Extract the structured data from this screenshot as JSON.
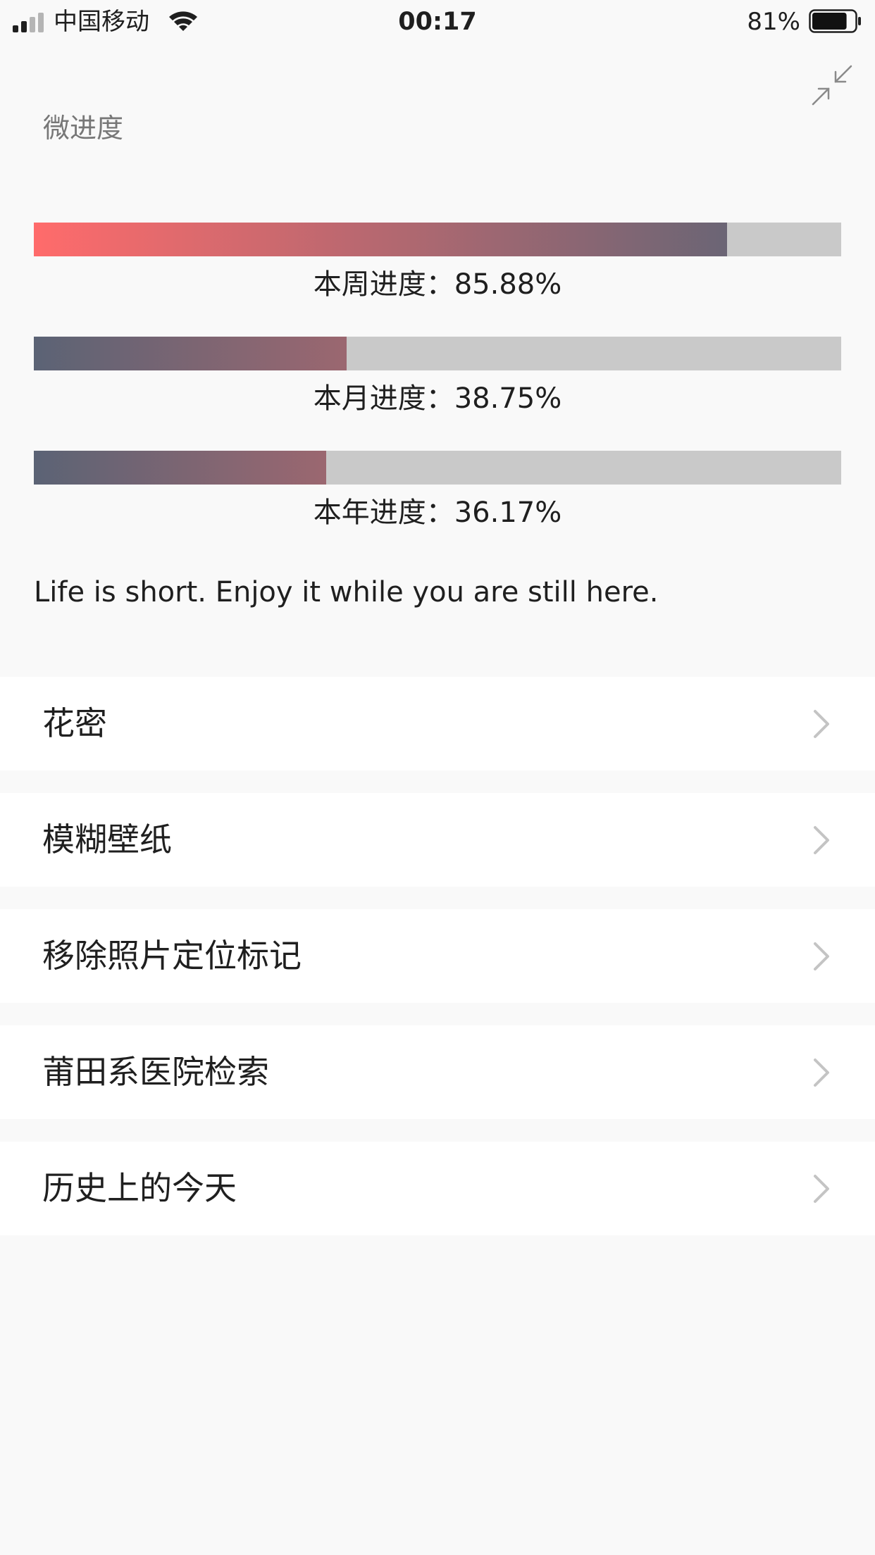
{
  "status_bar": {
    "carrier": "中国移动",
    "time": "00:17",
    "battery_percent": "81%",
    "battery_level": 0.81,
    "signal_bars_filled": 2,
    "signal_bars_total": 4
  },
  "widget": {
    "title": "微进度",
    "collapse_icon": "collapse-arrows-icon",
    "progress": [
      {
        "label": "本周进度：85.88%",
        "value": 0.8588,
        "gradient_start": "#ff6b6b",
        "gradient_end": "#6b6575"
      },
      {
        "label": "本月进度：38.75%",
        "value": 0.3875,
        "gradient_start": "#5b6375",
        "gradient_end": "#9b6770"
      },
      {
        "label": "本年进度：36.17%",
        "value": 0.3617,
        "gradient_start": "#5b6375",
        "gradient_end": "#9b6770"
      }
    ],
    "track_color": "#c9c9c9",
    "quote": "Life is short. Enjoy it while you are still here."
  },
  "menu": {
    "items": [
      {
        "label": "花密"
      },
      {
        "label": "模糊壁纸"
      },
      {
        "label": "移除照片定位标记"
      },
      {
        "label": "莆田系医院检索"
      },
      {
        "label": "历史上的今天"
      }
    ],
    "chevron_icon": "chevron-right-icon"
  }
}
